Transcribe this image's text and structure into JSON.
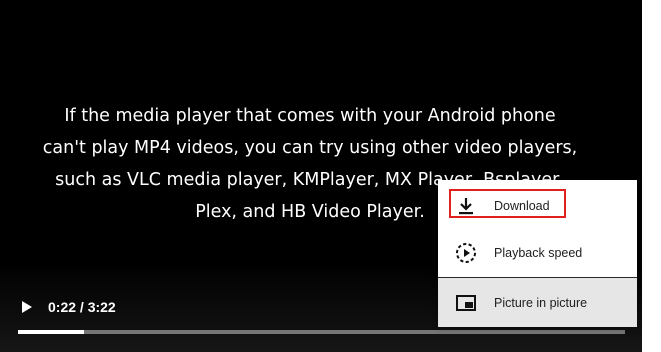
{
  "video": {
    "caption_lines": [
      "If the media player that comes with your Android phone",
      "can't play MP4 videos, you can try using other video players,",
      "such as VLC media player, KMPlayer, MX Player, Bsplayer,",
      "Plex, and HB Video Player."
    ],
    "background_color": "#000000"
  },
  "controls": {
    "play_icon": "play-icon",
    "time_display": "0:22 / 3:22",
    "progress_fraction": 0.1089
  },
  "menu": {
    "items": [
      {
        "label": "Download",
        "icon": "download-icon",
        "highlighted": true
      },
      {
        "label": "Playback speed",
        "icon": "playback-speed-icon",
        "highlighted": false
      },
      {
        "label": "Picture in picture",
        "icon": "picture-in-picture-icon",
        "highlighted": false
      }
    ],
    "highlight_color": "#e0201c"
  }
}
